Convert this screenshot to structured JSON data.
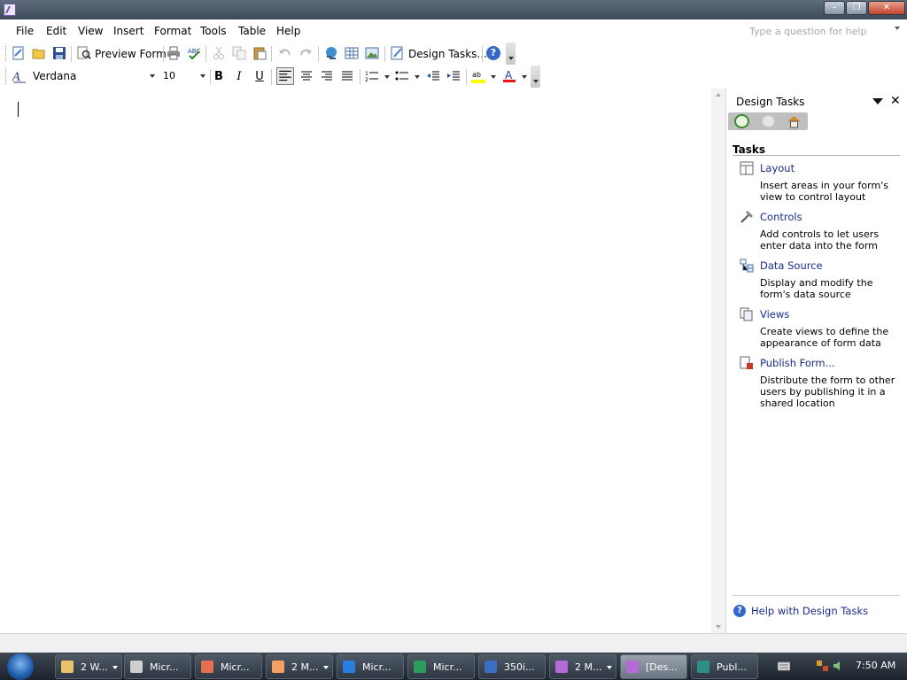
{
  "menu": {
    "items": [
      "File",
      "Edit",
      "View",
      "Insert",
      "Format",
      "Tools",
      "Table",
      "Help"
    ],
    "question_placeholder": "Type a question for help"
  },
  "toolbar": {
    "preview_form": "Preview Form",
    "design_tasks": "Design Tasks..."
  },
  "formatting": {
    "font": "Verdana",
    "size": "10",
    "bold": "B",
    "italic": "I",
    "underline": "U"
  },
  "taskpane": {
    "title": "Design Tasks",
    "section": "Tasks",
    "tasks": [
      {
        "label": "Layout",
        "desc": "Insert areas in your form's view to control layout"
      },
      {
        "label": "Controls",
        "desc": "Add controls to let users enter data into the form"
      },
      {
        "label": "Data Source",
        "desc": "Display and modify the form's data source"
      },
      {
        "label": "Views",
        "desc": "Create views to define the appearance of form data"
      },
      {
        "label": "Publish Form...",
        "desc": "Distribute the form to other users by publishing it in a shared location"
      }
    ],
    "help": "Help with Design Tasks"
  },
  "taskbar": {
    "items": [
      {
        "label": "2 W...",
        "icon": "folder-icon",
        "color": "#e9c46a"
      },
      {
        "label": "Micr...",
        "icon": "pen-icon",
        "color": "#cfcfcf"
      },
      {
        "label": "Micr...",
        "icon": "outlook-icon",
        "color": "#e76f51"
      },
      {
        "label": "2 M...",
        "icon": "messenger-icon",
        "color": "#f4a261"
      },
      {
        "label": "Micr...",
        "icon": "ie-icon",
        "color": "#2a7de1"
      },
      {
        "label": "Micr...",
        "icon": "excel-icon",
        "color": "#2a9d5c"
      },
      {
        "label": "350i...",
        "icon": "word-icon",
        "color": "#3a6fc4"
      },
      {
        "label": "2 M...",
        "icon": "infopath-icon",
        "color": "#b56ad6"
      },
      {
        "label": "[Des...",
        "icon": "infopath-icon",
        "color": "#b56ad6"
      },
      {
        "label": "Publ...",
        "icon": "publisher-icon",
        "color": "#2d8f86"
      }
    ],
    "clock": "7:50 AM"
  }
}
